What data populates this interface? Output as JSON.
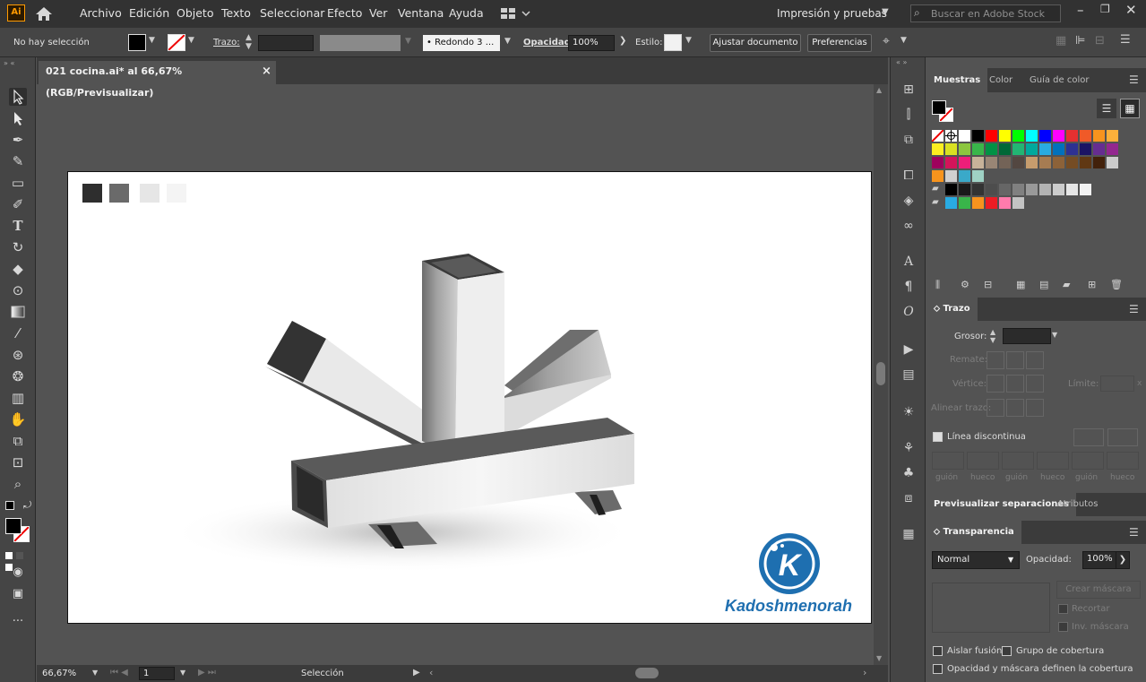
{
  "app": {
    "logo": "Ai"
  },
  "menu": [
    "Archivo",
    "Edición",
    "Objeto",
    "Texto",
    "Seleccionar",
    "Efecto",
    "Ver",
    "Ventana",
    "Ayuda"
  ],
  "workspace": "Impresión y pruebas",
  "search_placeholder": "Buscar en Adobe Stock",
  "control": {
    "selection": "No hay selección",
    "stroke_label": "Trazo:",
    "brush": "Redondo 3 ...",
    "opacity_label": "Opacidad:",
    "opacity_value": "100%",
    "style_label": "Estilo:",
    "adjust_doc": "Ajustar documento",
    "prefs": "Preferencias"
  },
  "document": {
    "tab": "021 cocina.ai* al 66,67% (RGB/Previsualizar)",
    "close": "×"
  },
  "status": {
    "zoom": "66,67%",
    "page": "1",
    "tool": "Selección"
  },
  "artwork": {
    "logo_letter": "K",
    "watermark": "Kadoshmenorah",
    "palette": [
      "#2e2e2e",
      "#6a6a6a",
      "#e6e6e6",
      "#f4f4f4"
    ]
  },
  "swatches_panel": {
    "tabs": [
      "Muestras",
      "Color",
      "Guía de color"
    ],
    "rows": [
      [
        "none",
        "reg",
        "#ffffff",
        "#000000",
        "#ff0000",
        "#ffff00",
        "#00ff00",
        "#00ffff",
        "#0000ff",
        "#ff00ff",
        "#e63030",
        "#f05a28",
        "#f7931e",
        "#fbb03b"
      ],
      [
        "#fcee21",
        "#d9e021",
        "#8cc63f",
        "#39b54a",
        "#009245",
        "#006837",
        "#22b573",
        "#00a99d",
        "#29abe2",
        "#0071bc",
        "#2e3192",
        "#1b1464",
        "#662d91",
        "#93278f"
      ],
      [
        "#9e005d",
        "#d4145a",
        "#ed1e79",
        "#c7b299",
        "#998675",
        "#736357",
        "#534741",
        "#c69c6d",
        "#a67c52",
        "#8c6239",
        "#754c24",
        "#603813",
        "#42210b",
        "#ccc"
      ]
    ],
    "grays": [
      "#000000",
      "#1a1a1a",
      "#333333",
      "#4d4d4d",
      "#666666",
      "#808080",
      "#999999",
      "#b3b3b3",
      "#cccccc",
      "#e6e6e6",
      "#f2f2f2"
    ],
    "brights": [
      "#29abe2",
      "#39b54a",
      "#f7931e",
      "#ed1c24",
      "#ff7bac",
      "#c3c3c3"
    ]
  },
  "stroke_panel": {
    "title": "Trazo",
    "weight": "Grosor:",
    "cap": "Remate:",
    "corner": "Vértice:",
    "limit": "Límite:",
    "align": "Alinear trazo:",
    "dashed": "Línea discontinua",
    "dash_labels": [
      "guión",
      "hueco",
      "guión",
      "hueco",
      "guión",
      "hueco"
    ]
  },
  "sep_tabs": [
    "Previsualizar separaciones",
    "Atributos"
  ],
  "transparency": {
    "title": "Transparencia",
    "mode": "Normal",
    "opacity_label": "Opacidad:",
    "opacity": "100%",
    "mask_button": "Crear máscara",
    "clip": "Recortar",
    "invert": "Inv. máscara",
    "isolate": "Aislar fusión",
    "knockout": "Grupo de cobertura",
    "opacity_mask": "Opacidad y máscara definen la cobertura"
  },
  "colors": {
    "accent": "#1f82c0",
    "logo_bg": "#1e6fb0",
    "menubar": "#323232",
    "panel": "#535353"
  }
}
